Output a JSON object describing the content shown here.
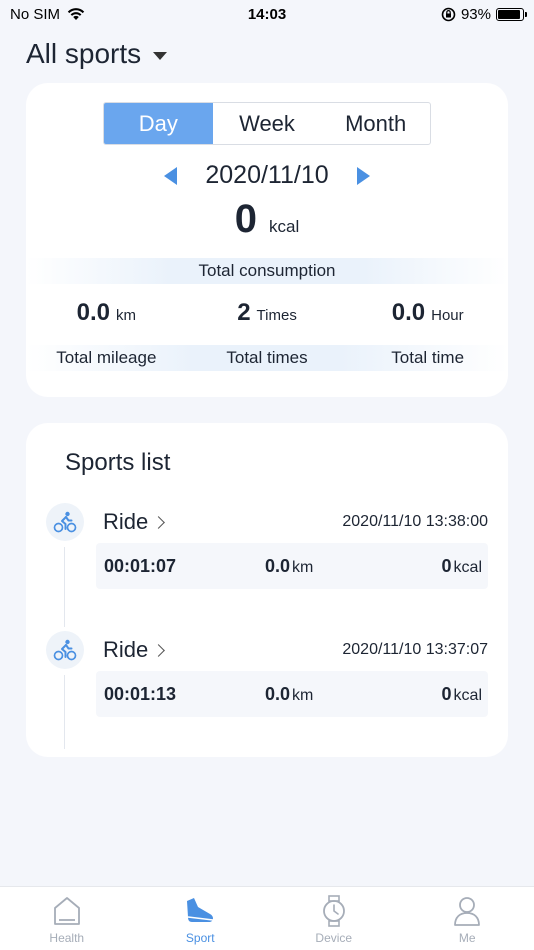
{
  "status_bar": {
    "carrier": "No SIM",
    "time": "14:03",
    "battery_percent": "93%",
    "battery_level": 0.93
  },
  "header": {
    "title": "All sports"
  },
  "summary": {
    "tabs": [
      {
        "label": "Day",
        "active": true
      },
      {
        "label": "Week",
        "active": false
      },
      {
        "label": "Month",
        "active": false
      }
    ],
    "date": "2020/11/10",
    "kcal_value": "0",
    "kcal_unit": "kcal",
    "consumption_label": "Total consumption",
    "stats": [
      {
        "value": "0.0",
        "unit": "km",
        "label": "Total mileage"
      },
      {
        "value": "2",
        "unit": "Times",
        "label": "Total times"
      },
      {
        "value": "0.0",
        "unit": "Hour",
        "label": "Total time"
      }
    ]
  },
  "sports_list": {
    "title": "Sports list",
    "entries": [
      {
        "name": "Ride",
        "datetime": "2020/11/10 13:38:00",
        "duration": "00:01:07",
        "distance": "0.0",
        "distance_unit": "km",
        "calories": "0",
        "calories_unit": "kcal"
      },
      {
        "name": "Ride",
        "datetime": "2020/11/10 13:37:07",
        "duration": "00:01:13",
        "distance": "0.0",
        "distance_unit": "km",
        "calories": "0",
        "calories_unit": "kcal"
      }
    ]
  },
  "tab_bar": {
    "items": [
      {
        "label": "Health",
        "icon": "health-icon",
        "active": false
      },
      {
        "label": "Sport",
        "icon": "sport-shoe-icon",
        "active": true
      },
      {
        "label": "Device",
        "icon": "watch-icon",
        "active": false
      },
      {
        "label": "Me",
        "icon": "person-icon",
        "active": false
      }
    ]
  },
  "colors": {
    "accent": "#4a90e2",
    "segment_active": "#6aa6ee",
    "tab_inactive": "#a6adb8"
  }
}
